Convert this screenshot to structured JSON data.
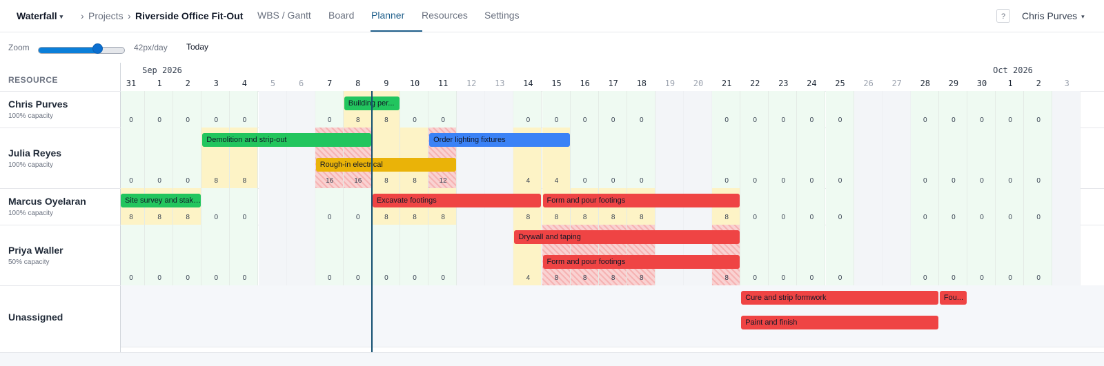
{
  "topbar": {
    "brand": "Waterfall",
    "crumb_sep": "›",
    "crumb_projects": "Projects",
    "crumb_current": "Riverside Office Fit-Out",
    "tabs": [
      {
        "label": "WBS / Gantt",
        "active": false
      },
      {
        "label": "Board",
        "active": false
      },
      {
        "label": "Planner",
        "active": true
      },
      {
        "label": "Resources",
        "active": false
      },
      {
        "label": "Settings",
        "active": false
      }
    ],
    "help": "?",
    "user": "Chris Purves"
  },
  "toolbar": {
    "zoom_label": "Zoom",
    "zoom_value": "42px/day",
    "zoom_level": 0.68,
    "today_label": "Today"
  },
  "planner": {
    "resource_header": "RESOURCE",
    "months": [
      {
        "label": "Sep 2026",
        "start_index": 1
      },
      {
        "label": "Oct 2026",
        "start_index": 31
      }
    ],
    "days": [
      "31",
      "1",
      "2",
      "3",
      "4",
      "5",
      "6",
      "7",
      "8",
      "9",
      "10",
      "11",
      "12",
      "13",
      "14",
      "15",
      "16",
      "17",
      "18",
      "19",
      "20",
      "21",
      "22",
      "23",
      "24",
      "25",
      "26",
      "27",
      "28",
      "29",
      "30",
      "1",
      "2",
      "3"
    ],
    "weekend_indexes": [
      5,
      6,
      12,
      13,
      19,
      20,
      26,
      27,
      33
    ],
    "today_index": 9,
    "resources": [
      {
        "name": "Chris Purves",
        "capacity": "100% capacity",
        "loads": [
          "0",
          "0",
          "0",
          "0",
          "0",
          "",
          "",
          "0",
          "8",
          "8",
          "0",
          "0",
          "",
          "",
          "0",
          "0",
          "0",
          "0",
          "0",
          "",
          "",
          "0",
          "0",
          "0",
          "0",
          "0",
          "",
          "",
          "0",
          "0",
          "0",
          "0",
          "0",
          ""
        ],
        "cell_states": [
          "f",
          "f",
          "f",
          "f",
          "f",
          "w",
          "w",
          "f",
          "y",
          "y",
          "f",
          "f",
          "w",
          "w",
          "f",
          "f",
          "f",
          "f",
          "f",
          "w",
          "w",
          "f",
          "f",
          "f",
          "f",
          "f",
          "w",
          "w",
          "f",
          "f",
          "f",
          "f",
          "f",
          "w"
        ],
        "bars": [
          {
            "label": "Building per...",
            "start": 8,
            "span": 2,
            "lane": 0,
            "color": "#22c55e"
          }
        ]
      },
      {
        "name": "Julia Reyes",
        "capacity": "100% capacity",
        "loads": [
          "0",
          "0",
          "0",
          "8",
          "8",
          "",
          "",
          "16",
          "16",
          "8",
          "8",
          "12",
          "",
          "",
          "4",
          "4",
          "0",
          "0",
          "0",
          "",
          "",
          "0",
          "0",
          "0",
          "0",
          "0",
          "",
          "",
          "0",
          "0",
          "0",
          "0",
          "0",
          ""
        ],
        "cell_states": [
          "f",
          "f",
          "f",
          "y",
          "y",
          "w",
          "w",
          "o",
          "o",
          "y",
          "y",
          "o",
          "w",
          "w",
          "y",
          "y",
          "f",
          "f",
          "f",
          "w",
          "w",
          "f",
          "f",
          "f",
          "f",
          "f",
          "w",
          "w",
          "f",
          "f",
          "f",
          "f",
          "f",
          "w"
        ],
        "bars": [
          {
            "label": "Demolition and strip-out",
            "start": 3,
            "span": 6,
            "lane": 0,
            "color": "#22c55e"
          },
          {
            "label": "Order lighting fixtures",
            "start": 11,
            "span": 5,
            "lane": 0,
            "color": "#3b82f6"
          },
          {
            "label": "Rough-in electrical",
            "start": 7,
            "span": 5,
            "lane": 1,
            "color": "#eab308"
          }
        ]
      },
      {
        "name": "Marcus Oyelaran",
        "capacity": "100% capacity",
        "loads": [
          "8",
          "8",
          "8",
          "0",
          "0",
          "",
          "",
          "0",
          "0",
          "8",
          "8",
          "8",
          "",
          "",
          "8",
          "8",
          "8",
          "8",
          "8",
          "",
          "",
          "8",
          "0",
          "0",
          "0",
          "0",
          "",
          "",
          "0",
          "0",
          "0",
          "0",
          "0",
          ""
        ],
        "cell_states": [
          "y",
          "y",
          "y",
          "f",
          "f",
          "w",
          "w",
          "f",
          "f",
          "y",
          "y",
          "y",
          "w",
          "w",
          "y",
          "y",
          "y",
          "y",
          "y",
          "w",
          "w",
          "y",
          "f",
          "f",
          "f",
          "f",
          "w",
          "w",
          "f",
          "f",
          "f",
          "f",
          "f",
          "w"
        ],
        "bars": [
          {
            "label": "Site survey and staki...",
            "start": 0,
            "span": 3,
            "lane": 0,
            "color": "#22c55e"
          },
          {
            "label": "Excavate footings",
            "start": 9,
            "span": 6,
            "lane": 0,
            "color": "#ef4444"
          },
          {
            "label": "Form and pour footings",
            "start": 15,
            "span": 7,
            "lane": 0,
            "color": "#ef4444"
          }
        ]
      },
      {
        "name": "Priya Waller",
        "capacity": "50% capacity",
        "loads": [
          "0",
          "0",
          "0",
          "0",
          "0",
          "",
          "",
          "0",
          "0",
          "0",
          "0",
          "0",
          "",
          "",
          "4",
          "8",
          "8",
          "8",
          "8",
          "",
          "",
          "8",
          "0",
          "0",
          "0",
          "0",
          "",
          "",
          "0",
          "0",
          "0",
          "0",
          "0",
          ""
        ],
        "cell_states": [
          "f",
          "f",
          "f",
          "f",
          "f",
          "w",
          "w",
          "f",
          "f",
          "f",
          "f",
          "f",
          "w",
          "w",
          "y",
          "o",
          "o",
          "o",
          "o",
          "w",
          "w",
          "o",
          "f",
          "f",
          "f",
          "f",
          "w",
          "w",
          "f",
          "f",
          "f",
          "f",
          "f",
          "w"
        ],
        "bars": [
          {
            "label": "Drywall and taping",
            "start": 14,
            "span": 8,
            "lane": 0,
            "color": "#ef4444"
          },
          {
            "label": "Form and pour footings",
            "start": 15,
            "span": 7,
            "lane": 1,
            "color": "#ef4444"
          }
        ]
      },
      {
        "name": "Unassigned",
        "capacity": "",
        "loads": [],
        "cell_states": [],
        "bars": [
          {
            "label": "Cure and strip formwork",
            "start": 22,
            "span": 7,
            "lane": 0,
            "color": "#ef4444"
          },
          {
            "label": "Fou...",
            "start": 29,
            "span": 1,
            "lane": 0,
            "color": "#ef4444"
          },
          {
            "label": "Paint and finish",
            "start": 22,
            "span": 7,
            "lane": 1,
            "color": "#ef4444"
          }
        ]
      }
    ]
  }
}
